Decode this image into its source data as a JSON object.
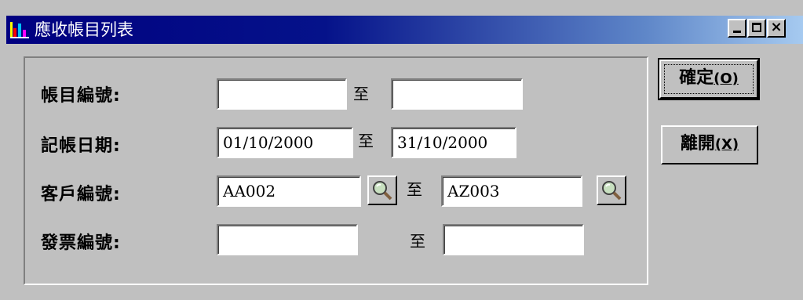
{
  "window": {
    "title": "應收帳目列表",
    "controls": {
      "minimize_icon": "minimize-icon",
      "maximize_icon": "maximize-icon",
      "close_glyph": "×"
    }
  },
  "form": {
    "rows": [
      {
        "label": "帳目編號:",
        "from_value": "",
        "to_label": "至",
        "to_value": ""
      },
      {
        "label": "記帳日期:",
        "from_value": "01/10/2000",
        "to_label": "至",
        "to_value": "31/10/2000"
      },
      {
        "label": "客戶編號:",
        "from_value": "AA002",
        "to_label": "至",
        "to_value": "AZ003",
        "lookup_icon": "magnifier-icon"
      },
      {
        "label": "發票編號:",
        "from_value": "",
        "to_label": "至",
        "to_value": ""
      }
    ]
  },
  "buttons": {
    "confirm": {
      "label": "確定",
      "shortcut": "(O)"
    },
    "exit": {
      "label": "離開",
      "shortcut": "(X)"
    }
  },
  "colors": {
    "title_start": "#000080",
    "title_end": "#a6caf0",
    "face": "#c0c0c0"
  }
}
